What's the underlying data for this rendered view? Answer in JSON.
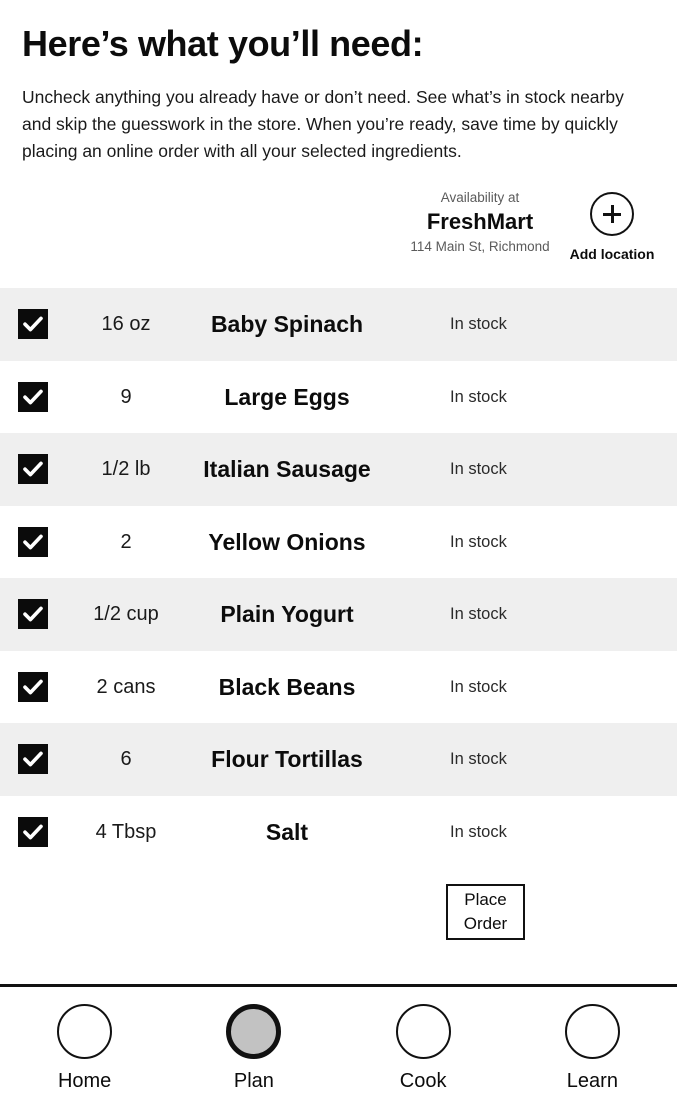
{
  "header": {
    "title": "Here’s what you’ll need:",
    "intro": "Uncheck anything you already have or don’t need.  See what’s in stock nearby and skip the guesswork in the store.  When you’re ready, save time by quickly placing an online order with all your selected ingredients."
  },
  "store": {
    "availability_label": "Availability at",
    "name": "FreshMart",
    "address": "114 Main St, Richmond",
    "add_location_label": "Add location",
    "add_location_icon": "plus-circle-icon"
  },
  "ingredients": [
    {
      "checked": true,
      "quantity": "16 oz",
      "name": "Baby Spinach",
      "stock": "In stock"
    },
    {
      "checked": true,
      "quantity": "9",
      "name": "Large Eggs",
      "stock": "In stock"
    },
    {
      "checked": true,
      "quantity": "1/2 lb",
      "name": "Italian Sausage",
      "stock": "In stock"
    },
    {
      "checked": true,
      "quantity": "2",
      "name": "Yellow Onions",
      "stock": "In stock"
    },
    {
      "checked": true,
      "quantity": "1/2 cup",
      "name": "Plain Yogurt",
      "stock": "In stock"
    },
    {
      "checked": true,
      "quantity": "2 cans",
      "name": "Black Beans",
      "stock": "In stock"
    },
    {
      "checked": true,
      "quantity": "6",
      "name": "Flour Tortillas",
      "stock": "In stock"
    },
    {
      "checked": true,
      "quantity": "4 Tbsp",
      "name": "Salt",
      "stock": "In stock"
    }
  ],
  "order": {
    "place_order_label": "Place\nOrder"
  },
  "bottom_nav": {
    "items": [
      {
        "label": "Home",
        "icon": "home-circle-icon",
        "active": false
      },
      {
        "label": "Plan",
        "icon": "plan-circle-icon",
        "active": true
      },
      {
        "label": "Cook",
        "icon": "cook-circle-icon",
        "active": false
      },
      {
        "label": "Learn",
        "icon": "learn-circle-icon",
        "active": false
      }
    ]
  },
  "colors": {
    "row_alt_background": "#efefef",
    "checkbox_fill": "#0b0b0b",
    "active_nav_fill": "#c2c2c2",
    "text": "#111111"
  }
}
